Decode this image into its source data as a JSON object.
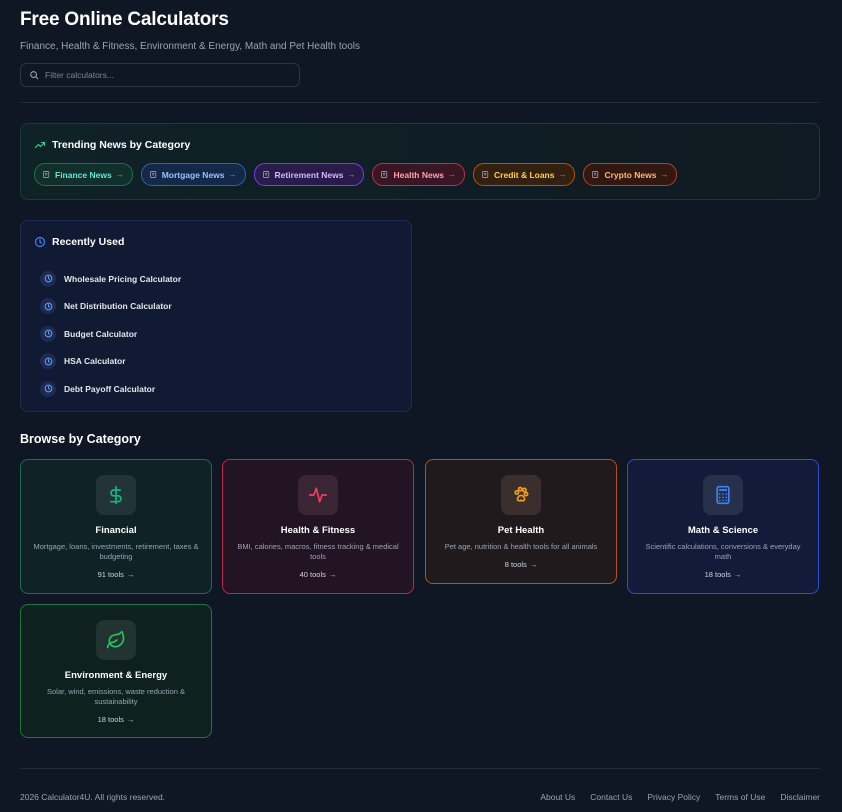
{
  "header": {
    "title": "Free Online Calculators",
    "subtitle": "Finance, Health & Fitness, Environment & Energy, Math and Pet Health tools"
  },
  "search": {
    "placeholder": "Filter calculators..."
  },
  "news": {
    "title": "Trending News by Category",
    "chips": [
      {
        "label": "Finance News",
        "arrow": "→"
      },
      {
        "label": "Mortgage News",
        "arrow": "→"
      },
      {
        "label": "Retirement News",
        "arrow": "→"
      },
      {
        "label": "Health News",
        "arrow": "→"
      },
      {
        "label": "Credit & Loans",
        "arrow": "→"
      },
      {
        "label": "Crypto News",
        "arrow": "→"
      }
    ]
  },
  "recent": {
    "title": "Recently Used",
    "items": [
      {
        "label": "Wholesale Pricing Calculator"
      },
      {
        "label": "Net Distribution Calculator"
      },
      {
        "label": "Budget Calculator"
      },
      {
        "label": "HSA Calculator"
      },
      {
        "label": "Debt Payoff Calculator"
      }
    ]
  },
  "browse": {
    "title": "Browse by Category",
    "cards": [
      {
        "title": "Financial",
        "desc": "Mortgage, loans, investments, retirement, taxes & budgeting",
        "count": "91 tools",
        "arrow": "→"
      },
      {
        "title": "Health & Fitness",
        "desc": "BMI, calories, macros, fitness tracking & medical tools",
        "count": "40 tools",
        "arrow": "→"
      },
      {
        "title": "Pet Health",
        "desc": "Pet age, nutrition & health tools for all animals",
        "count": "8 tools",
        "arrow": "→"
      },
      {
        "title": "Math & Science",
        "desc": "Scientific calculations, conversions & everyday math",
        "count": "18 tools",
        "arrow": "→"
      },
      {
        "title": "Environment & Energy",
        "desc": "Solar, wind, emissions, waste reduction & sustainability",
        "count": "18 tools",
        "arrow": "→"
      }
    ]
  },
  "footer": {
    "copyright": "2026 Calculator4U. All rights reserved.",
    "links": [
      "About Us",
      "Contact Us",
      "Privacy Policy",
      "Terms of Use",
      "Disclaimer"
    ]
  },
  "colors": {
    "background": "#0f1624",
    "financial": "#10b981",
    "health": "#f43f5e",
    "pet": "#f59e0b",
    "math": "#3b82f6",
    "environment": "#22c55e"
  },
  "icons": {
    "search": "search-icon",
    "trending": "trending-up-icon",
    "clock": "clock-icon",
    "newspaper": "newspaper-icon",
    "dollar": "dollar-icon",
    "pulse": "pulse-icon",
    "paw": "paw-icon",
    "calculator": "calculator-icon",
    "leaf": "leaf-icon"
  }
}
